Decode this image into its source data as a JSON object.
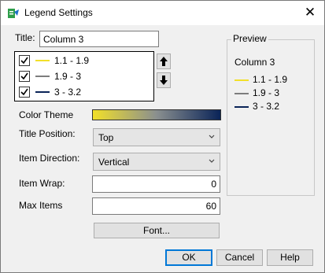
{
  "window": {
    "title": "Legend Settings",
    "close_glyph": "✕",
    "icon": "legend-settings-app-icon"
  },
  "title_field": {
    "label": "Title:",
    "value": "Column 3"
  },
  "items": [
    {
      "label": "1.1 - 1.9",
      "checked": true,
      "color": "#f2e02a"
    },
    {
      "label": "1.9 - 3",
      "checked": true,
      "color": "#7d7d7d"
    },
    {
      "label": "3 - 3.2",
      "checked": true,
      "color": "#0a2458"
    }
  ],
  "move_buttons": {
    "up": "arrow-up-icon",
    "down": "arrow-down-icon"
  },
  "color_theme": {
    "label": "Color Theme",
    "gradient": [
      "#f2e02a",
      "#8a8f8f",
      "#0a2458"
    ]
  },
  "title_position": {
    "label": "Title Position:",
    "value": "Top"
  },
  "item_direction": {
    "label": "Item Direction:",
    "value": "Vertical"
  },
  "item_wrap": {
    "label": "Item Wrap:",
    "value": "0"
  },
  "max_items": {
    "label": "Max Items",
    "value": "60"
  },
  "font_button": {
    "label": "Font..."
  },
  "preview": {
    "label": "Preview",
    "title": "Column 3",
    "items": [
      {
        "label": "1.1 - 1.9",
        "color": "#f2e02a"
      },
      {
        "label": "1.9 - 3",
        "color": "#7d7d7d"
      },
      {
        "label": "3 - 3.2",
        "color": "#0a2458"
      }
    ]
  },
  "buttons": {
    "ok": "OK",
    "cancel": "Cancel",
    "help": "Help"
  }
}
